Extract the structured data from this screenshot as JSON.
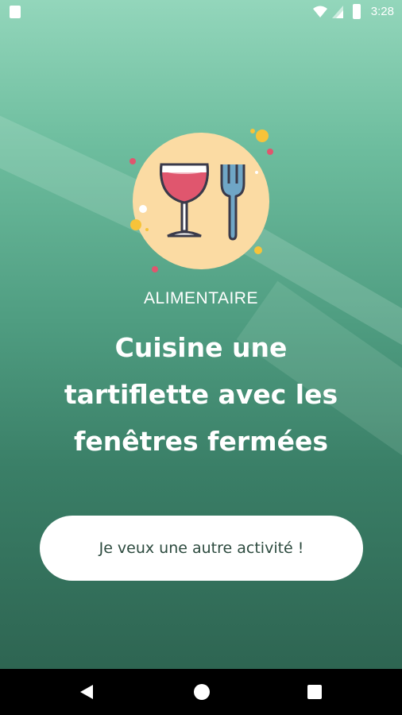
{
  "status_bar": {
    "time": "3:28",
    "icons": [
      "sd-card-icon",
      "wifi-icon",
      "signal-icon",
      "battery-icon"
    ]
  },
  "activity": {
    "category": "ALIMENTAIRE",
    "title_lines": [
      "Cuisine une",
      "tartiflette avec les",
      "fenêtres fermées"
    ],
    "illustration": "wine-glass-and-fork-icon"
  },
  "actions": {
    "another_activity_label": "Je veux une autre activité !"
  },
  "nav_bar": {
    "buttons": [
      "back-icon",
      "home-icon",
      "recents-icon"
    ]
  },
  "colors": {
    "background_top": "#93d6bb",
    "background_bottom": "#2e6552",
    "icon_circle": "#fbdba3",
    "wine": "#e0566e",
    "fork": "#6fa6c6",
    "button_text": "#2c4a3e"
  }
}
